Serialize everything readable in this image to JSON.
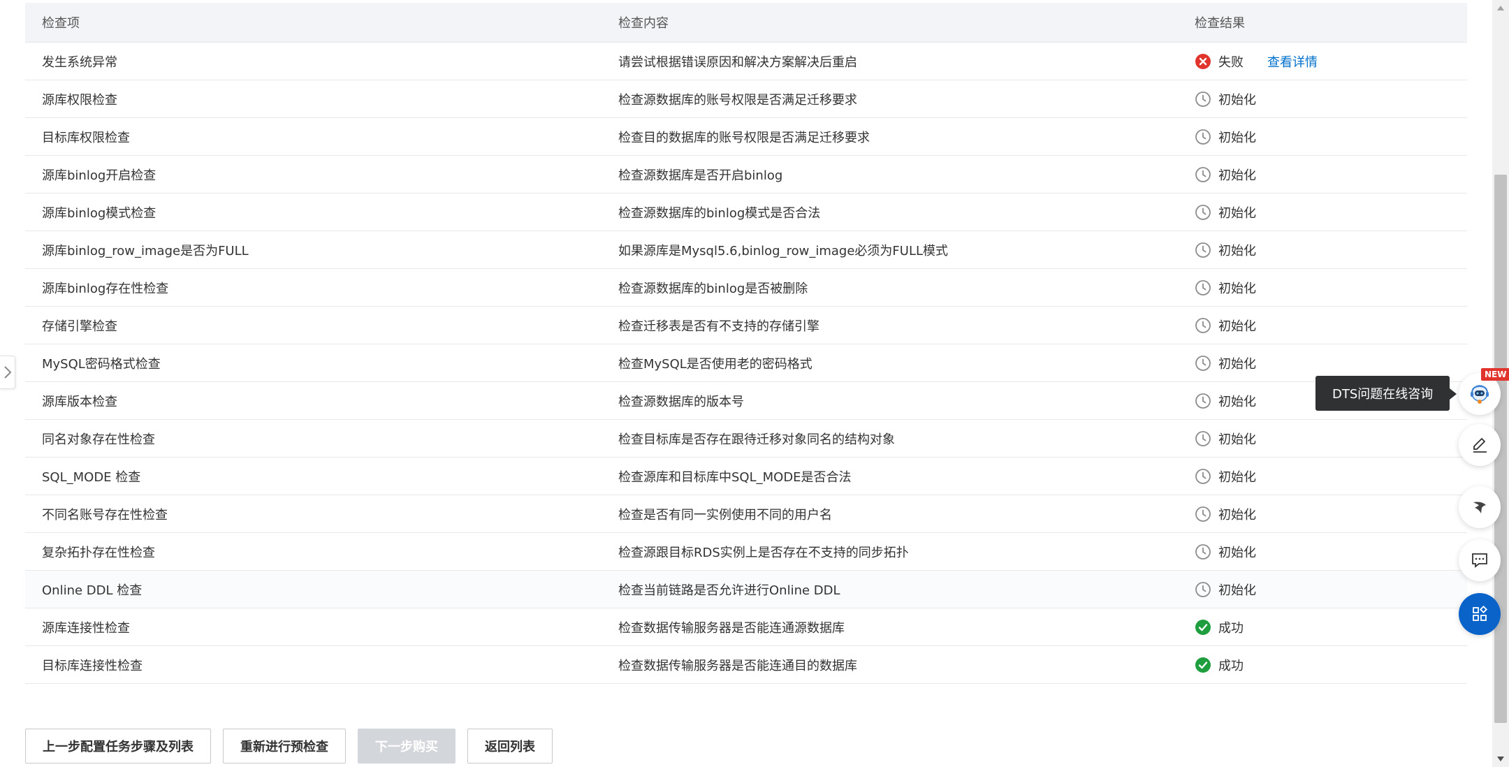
{
  "table": {
    "headers": [
      "检查项",
      "检查内容",
      "检查结果"
    ],
    "rows": [
      {
        "item": "发生系统异常",
        "content": "请尝试根据错误原因和解决方案解决后重启",
        "status": "失败",
        "status_type": "fail",
        "link": "查看详情"
      },
      {
        "item": "源库权限检查",
        "content": "检查源数据库的账号权限是否满足迁移要求",
        "status": "初始化",
        "status_type": "init"
      },
      {
        "item": "目标库权限检查",
        "content": "检查目的数据库的账号权限是否满足迁移要求",
        "status": "初始化",
        "status_type": "init"
      },
      {
        "item": "源库binlog开启检查",
        "content": "检查源数据库是否开启binlog",
        "status": "初始化",
        "status_type": "init"
      },
      {
        "item": "源库binlog模式检查",
        "content": "检查源数据库的binlog模式是否合法",
        "status": "初始化",
        "status_type": "init"
      },
      {
        "item": "源库binlog_row_image是否为FULL",
        "content": "如果源库是Mysql5.6,binlog_row_image必须为FULL模式",
        "status": "初始化",
        "status_type": "init"
      },
      {
        "item": "源库binlog存在性检查",
        "content": "检查源数据库的binlog是否被删除",
        "status": "初始化",
        "status_type": "init"
      },
      {
        "item": "存储引擎检查",
        "content": "检查迁移表是否有不支持的存储引擎",
        "status": "初始化",
        "status_type": "init"
      },
      {
        "item": "MySQL密码格式检查",
        "content": "检查MySQL是否使用老的密码格式",
        "status": "初始化",
        "status_type": "init"
      },
      {
        "item": "源库版本检查",
        "content": "检查源数据库的版本号",
        "status": "初始化",
        "status_type": "init"
      },
      {
        "item": "同名对象存在性检查",
        "content": "检查目标库是否存在跟待迁移对象同名的结构对象",
        "status": "初始化",
        "status_type": "init"
      },
      {
        "item": "SQL_MODE 检查",
        "content": "检查源库和目标库中SQL_MODE是否合法",
        "status": "初始化",
        "status_type": "init"
      },
      {
        "item": "不同名账号存在性检查",
        "content": "检查是否有同一实例使用不同的用户名",
        "status": "初始化",
        "status_type": "init"
      },
      {
        "item": "复杂拓扑存在性检查",
        "content": "检查源跟目标RDS实例上是否存在不支持的同步拓扑",
        "status": "初始化",
        "status_type": "init"
      },
      {
        "item": "Online DDL 检查",
        "content": "检查当前链路是否允许进行Online DDL",
        "status": "初始化",
        "status_type": "init"
      },
      {
        "item": "源库连接性检查",
        "content": "检查数据传输服务器是否能连通源数据库",
        "status": "成功",
        "status_type": "success"
      },
      {
        "item": "目标库连接性检查",
        "content": "检查数据传输服务器是否能连通目的数据库",
        "status": "成功",
        "status_type": "success"
      }
    ]
  },
  "actions": {
    "prev": "上一步配置任务步骤及列表",
    "recheck": "重新进行预检查",
    "next": "下一步购买",
    "back": "返回列表"
  },
  "floating": {
    "tooltip": "DTS问题在线咨询",
    "badge": "NEW",
    "icons": [
      "support-robot-icon",
      "edit-icon",
      "feedback-bird-icon",
      "chat-icon",
      "apps-icon"
    ]
  },
  "colors": {
    "fail": "#e0342c",
    "success": "#1e9e3e",
    "init": "#8c8c8c",
    "link": "#0070cc",
    "primary": "#0a63c8"
  }
}
